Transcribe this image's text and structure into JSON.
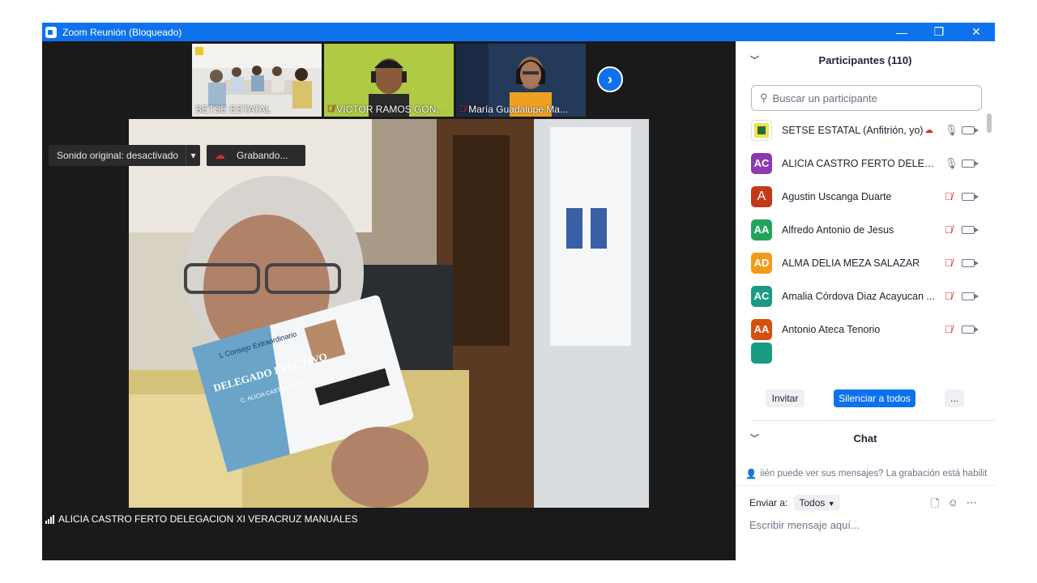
{
  "window": {
    "title": "Zoom Reunión (Bloqueado)",
    "controls": {
      "minimize": "—",
      "restore": "❐",
      "close": "✕"
    }
  },
  "thumbnails": [
    {
      "label": "SETSE ESTATAL",
      "muted": false
    },
    {
      "label": "VICTOR RAMOS GON...",
      "muted": true
    },
    {
      "label": "María Guadalupe Ma...",
      "muted": true
    }
  ],
  "next_button": "›",
  "toolbar": {
    "original_sound": "Sonido original: desactivado",
    "dropdown": "▾",
    "recording": "Grabando..."
  },
  "active_speaker": "ALICIA CASTRO FERTO DELEGACION XI VERACRUZ MANUALES",
  "card": {
    "title": "DELEGADO EFECTIVO",
    "header": "L Consejo Extraordinario",
    "name": "C. ALICIA CASTRO FERTO"
  },
  "participants": {
    "header": "Participantes (110)",
    "search_placeholder": "Buscar un participante",
    "items": [
      {
        "name": "SETSE ESTATAL (Anfitrión, yo)",
        "initials": "",
        "color": "#f2e24a",
        "mic": "on",
        "recording": true
      },
      {
        "name": "ALICIA CASTRO FERTO DELEGAC...",
        "initials": "AC",
        "color": "#8b3bb0",
        "mic": "on",
        "recording": false
      },
      {
        "name": "Agustin Uscanga Duarte",
        "initials": "A",
        "color": "#c2391a",
        "mic": "off",
        "recording": false
      },
      {
        "name": "Alfredo Antonio de Jesus",
        "initials": "AA",
        "color": "#23a45b",
        "mic": "off",
        "recording": false
      },
      {
        "name": "ALMA DELIA MEZA SALAZAR",
        "initials": "AD",
        "color": "#f19b1a",
        "mic": "off",
        "recording": false
      },
      {
        "name": "Amalia Córdova Diaz Acayucan ...",
        "initials": "AC",
        "color": "#1a9b83",
        "mic": "off",
        "recording": false
      },
      {
        "name": "Antonio Ateca Tenorio",
        "initials": "AA",
        "color": "#d4500f",
        "mic": "off",
        "recording": false
      }
    ],
    "actions": {
      "invite": "Invitar",
      "mute_all": "Silenciar a todos",
      "more": "..."
    }
  },
  "chat": {
    "header": "Chat",
    "notice": "iién puede ver sus mensajes? La grabación está habilit",
    "send_to_label": "Enviar a:",
    "send_to_value": "Todos",
    "input_placeholder": "Escribir mensaje aquí..."
  },
  "colors": {
    "accent": "#0e72ed",
    "muted_mic": "#e02828"
  }
}
